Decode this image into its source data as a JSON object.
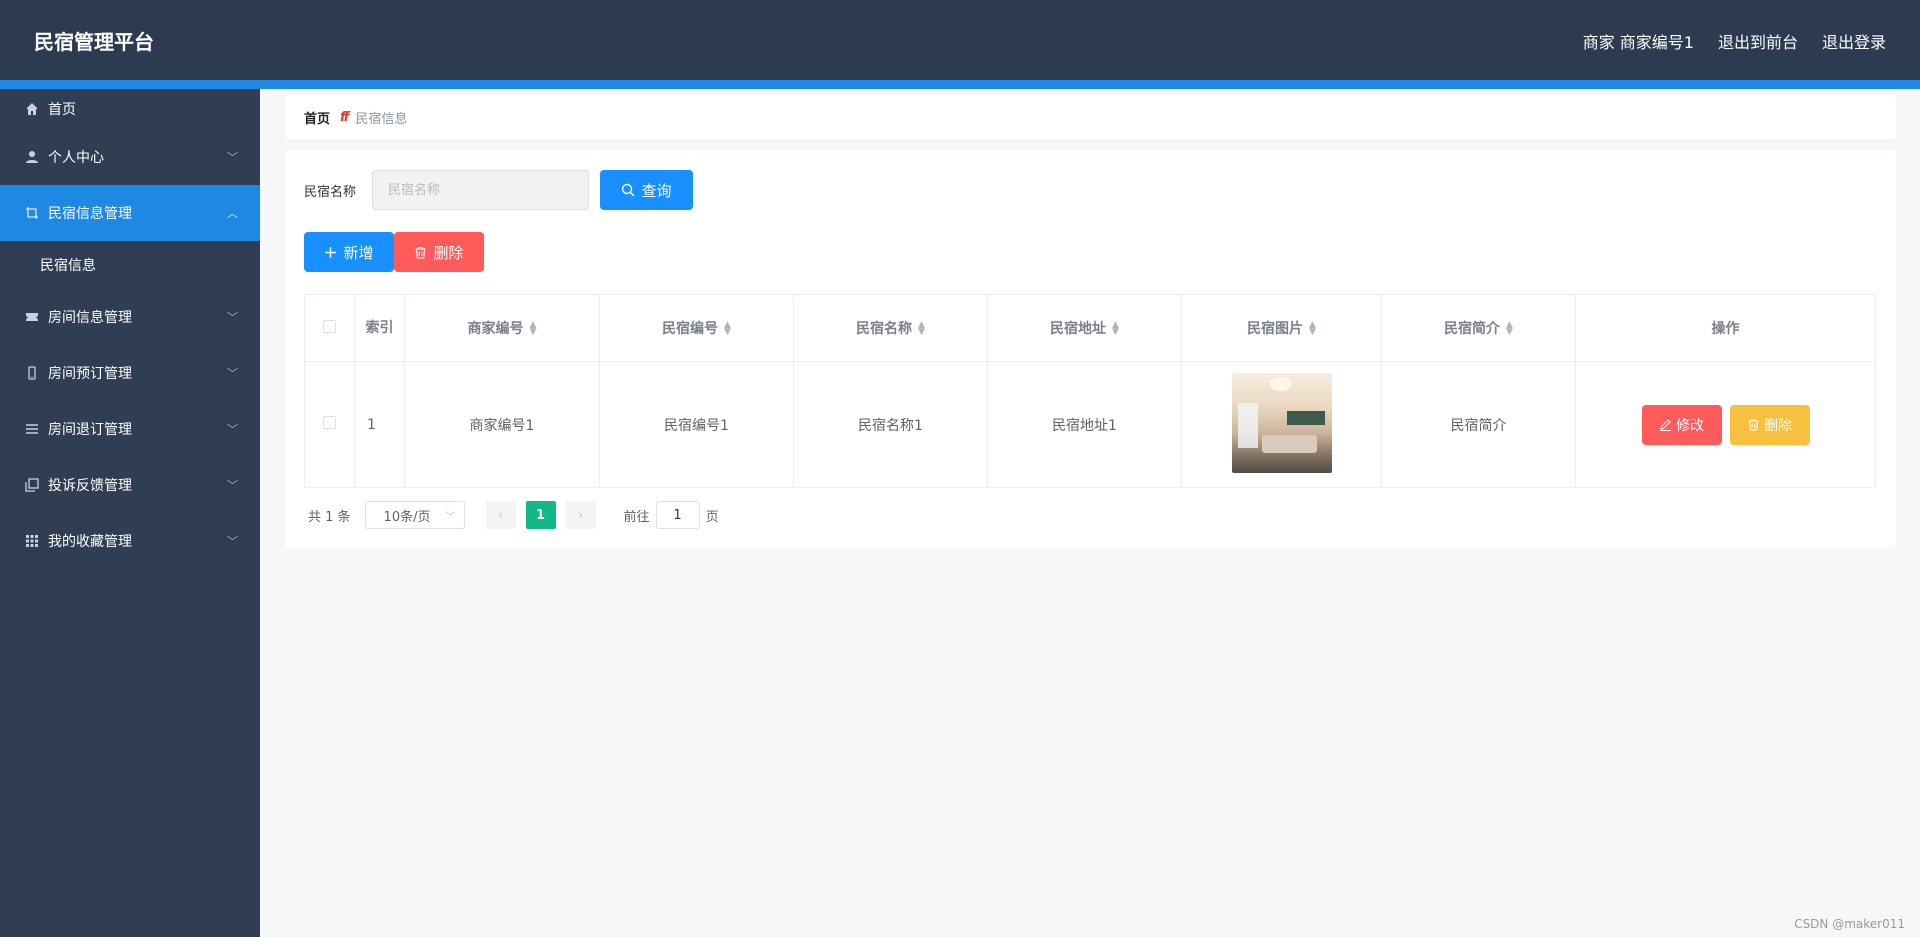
{
  "header": {
    "brand": "民宿管理平台",
    "user_label": "商家 商家编号1",
    "to_front": "退出到前台",
    "logout": "退出登录"
  },
  "sidebar": {
    "items": [
      {
        "label": "首页",
        "icon": "home-icon"
      },
      {
        "label": "个人中心",
        "icon": "user-icon"
      },
      {
        "label": "民宿信息管理",
        "icon": "crop-icon"
      },
      {
        "label": "民宿信息",
        "icon": ""
      },
      {
        "label": "房间信息管理",
        "icon": "ticket-icon"
      },
      {
        "label": "房间预订管理",
        "icon": "phone-icon"
      },
      {
        "label": "房间退订管理",
        "icon": "menu-icon"
      },
      {
        "label": "投诉反馈管理",
        "icon": "copy-icon"
      },
      {
        "label": "我的收藏管理",
        "icon": "grid-icon"
      }
    ]
  },
  "breadcrumb": {
    "home": "首页",
    "separator": "ff",
    "current": "民宿信息"
  },
  "search": {
    "label": "民宿名称",
    "placeholder": "民宿名称",
    "query_button": "查询"
  },
  "actions": {
    "add": "新增",
    "delete": "删除"
  },
  "table": {
    "headers": [
      "索引",
      "商家编号",
      "民宿编号",
      "民宿名称",
      "民宿地址",
      "民宿图片",
      "民宿简介",
      "操作"
    ],
    "rows": [
      {
        "index": "1",
        "merchant_no": "商家编号1",
        "homestay_no": "民宿编号1",
        "name": "民宿名称1",
        "address": "民宿地址1",
        "intro": "民宿简介",
        "edit": "修改",
        "delete": "删除"
      }
    ]
  },
  "pagination": {
    "total": "共 1 条",
    "page_size": "10条/页",
    "current_page": "1",
    "goto_label": "前往",
    "goto_value": "1",
    "page_suffix": "页"
  },
  "watermark": "CSDN @maker011",
  "colors": {
    "header_bg": "#2c3b50",
    "accent": "#1e88e5",
    "danger": "#ff5b5b",
    "warning": "#f7c03e",
    "page_active": "#12b886"
  }
}
